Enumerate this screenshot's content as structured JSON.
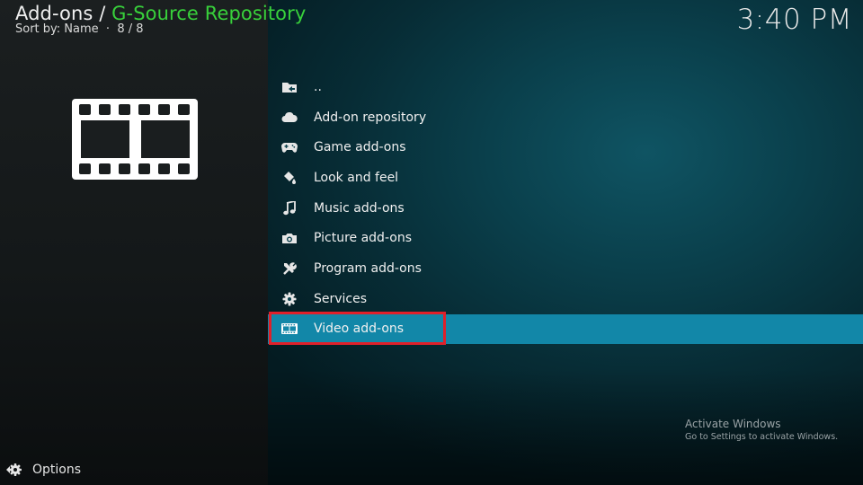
{
  "header": {
    "section": "Add-ons",
    "separator": " / ",
    "repository": "G-Source Repository",
    "sort_label": "Sort by: Name",
    "dot": "·",
    "count": "8 / 8",
    "clock": "3:40 PM"
  },
  "thumbnail": {
    "icon": "film-strip-icon"
  },
  "list": {
    "items": [
      {
        "label": "..",
        "icon": "parent-folder-icon"
      },
      {
        "label": "Add-on repository",
        "icon": "cloud-icon"
      },
      {
        "label": "Game add-ons",
        "icon": "gamepad-icon"
      },
      {
        "label": "Look and feel",
        "icon": "paint-bucket-icon"
      },
      {
        "label": "Music add-ons",
        "icon": "music-note-icon"
      },
      {
        "label": "Picture add-ons",
        "icon": "camera-icon"
      },
      {
        "label": "Program add-ons",
        "icon": "tools-icon"
      },
      {
        "label": "Services",
        "icon": "gear-icon"
      },
      {
        "label": "Video add-ons",
        "icon": "film-icon",
        "selected": true
      }
    ]
  },
  "footer": {
    "options_label": "Options",
    "options_icon": "options-icon"
  },
  "watermark": {
    "title": "Activate Windows",
    "subtitle": "Go to Settings to activate Windows."
  },
  "colors": {
    "accent": "#38d13b",
    "selection": "#1287a8",
    "annotation": "#e0202a"
  }
}
